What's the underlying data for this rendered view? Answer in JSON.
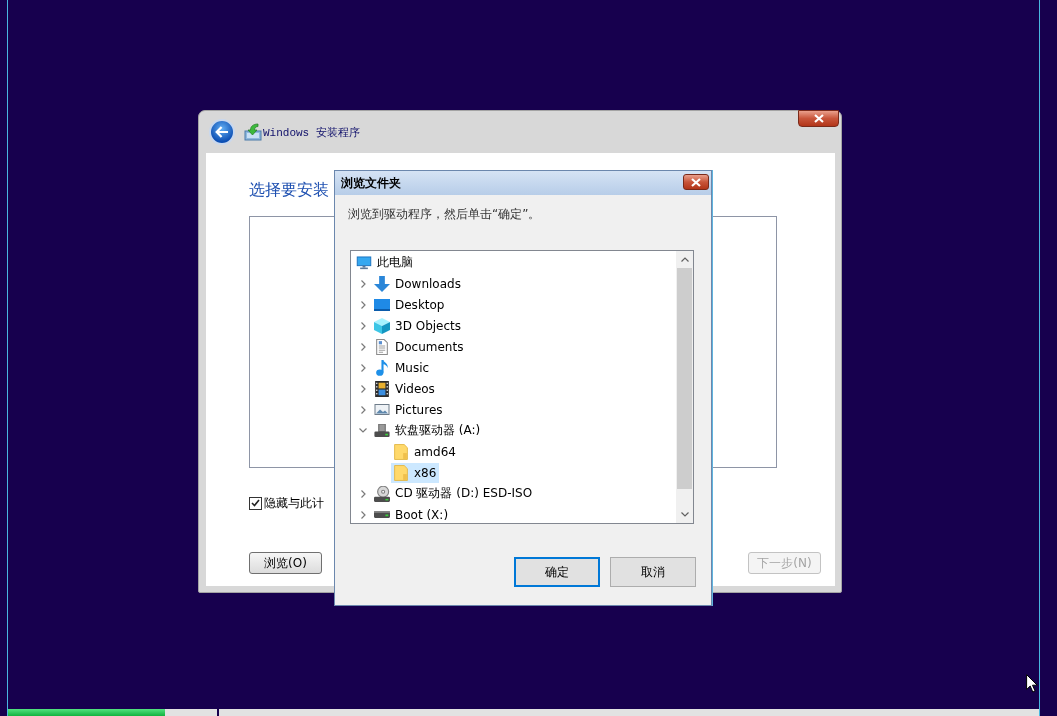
{
  "installer": {
    "title": "Windows 安装程序",
    "heading": "选择要安装",
    "hide_option": {
      "label": "隐藏与此计",
      "checked": true
    },
    "buttons": [
      {
        "label": "浏览(O)",
        "disabled": false
      },
      {
        "label": "下一步(N)",
        "disabled": true
      }
    ]
  },
  "dialog": {
    "title": "浏览文件夹",
    "instruction": "浏览到驱动程序，然后单击“确定”。",
    "tree": [
      {
        "label": "此电脑",
        "kind": "computer",
        "selected": false,
        "children": [
          {
            "label": "Downloads",
            "kind": "downloads",
            "expanded": false,
            "selected": false
          },
          {
            "label": "Desktop",
            "kind": "desktop",
            "expanded": false,
            "selected": false
          },
          {
            "label": "3D Objects",
            "kind": "objects",
            "expanded": false,
            "selected": false
          },
          {
            "label": "Documents",
            "kind": "documents",
            "expanded": false,
            "selected": false
          },
          {
            "label": "Music",
            "kind": "music",
            "expanded": false,
            "selected": false
          },
          {
            "label": "Videos",
            "kind": "videos",
            "expanded": false,
            "selected": false
          },
          {
            "label": "Pictures",
            "kind": "pictures",
            "expanded": false,
            "selected": false
          },
          {
            "label": "软盘驱动器 (A:)",
            "kind": "floppy",
            "expanded": true,
            "selected": false,
            "children": [
              {
                "label": "amd64",
                "kind": "folder",
                "selected": false
              },
              {
                "label": "x86",
                "kind": "folder",
                "selected": true
              }
            ]
          },
          {
            "label": "CD 驱动器 (D:) ESD-ISO",
            "kind": "cd",
            "expanded": false,
            "selected": false
          },
          {
            "label": "Boot (X:)",
            "kind": "drive",
            "expanded": false,
            "selected": false
          }
        ]
      }
    ],
    "buttons": [
      {
        "label": "确定",
        "focused": true
      },
      {
        "label": "取消",
        "focused": false
      }
    ]
  },
  "progress": [
    {
      "level": 0.75
    },
    {
      "level": 0
    }
  ]
}
